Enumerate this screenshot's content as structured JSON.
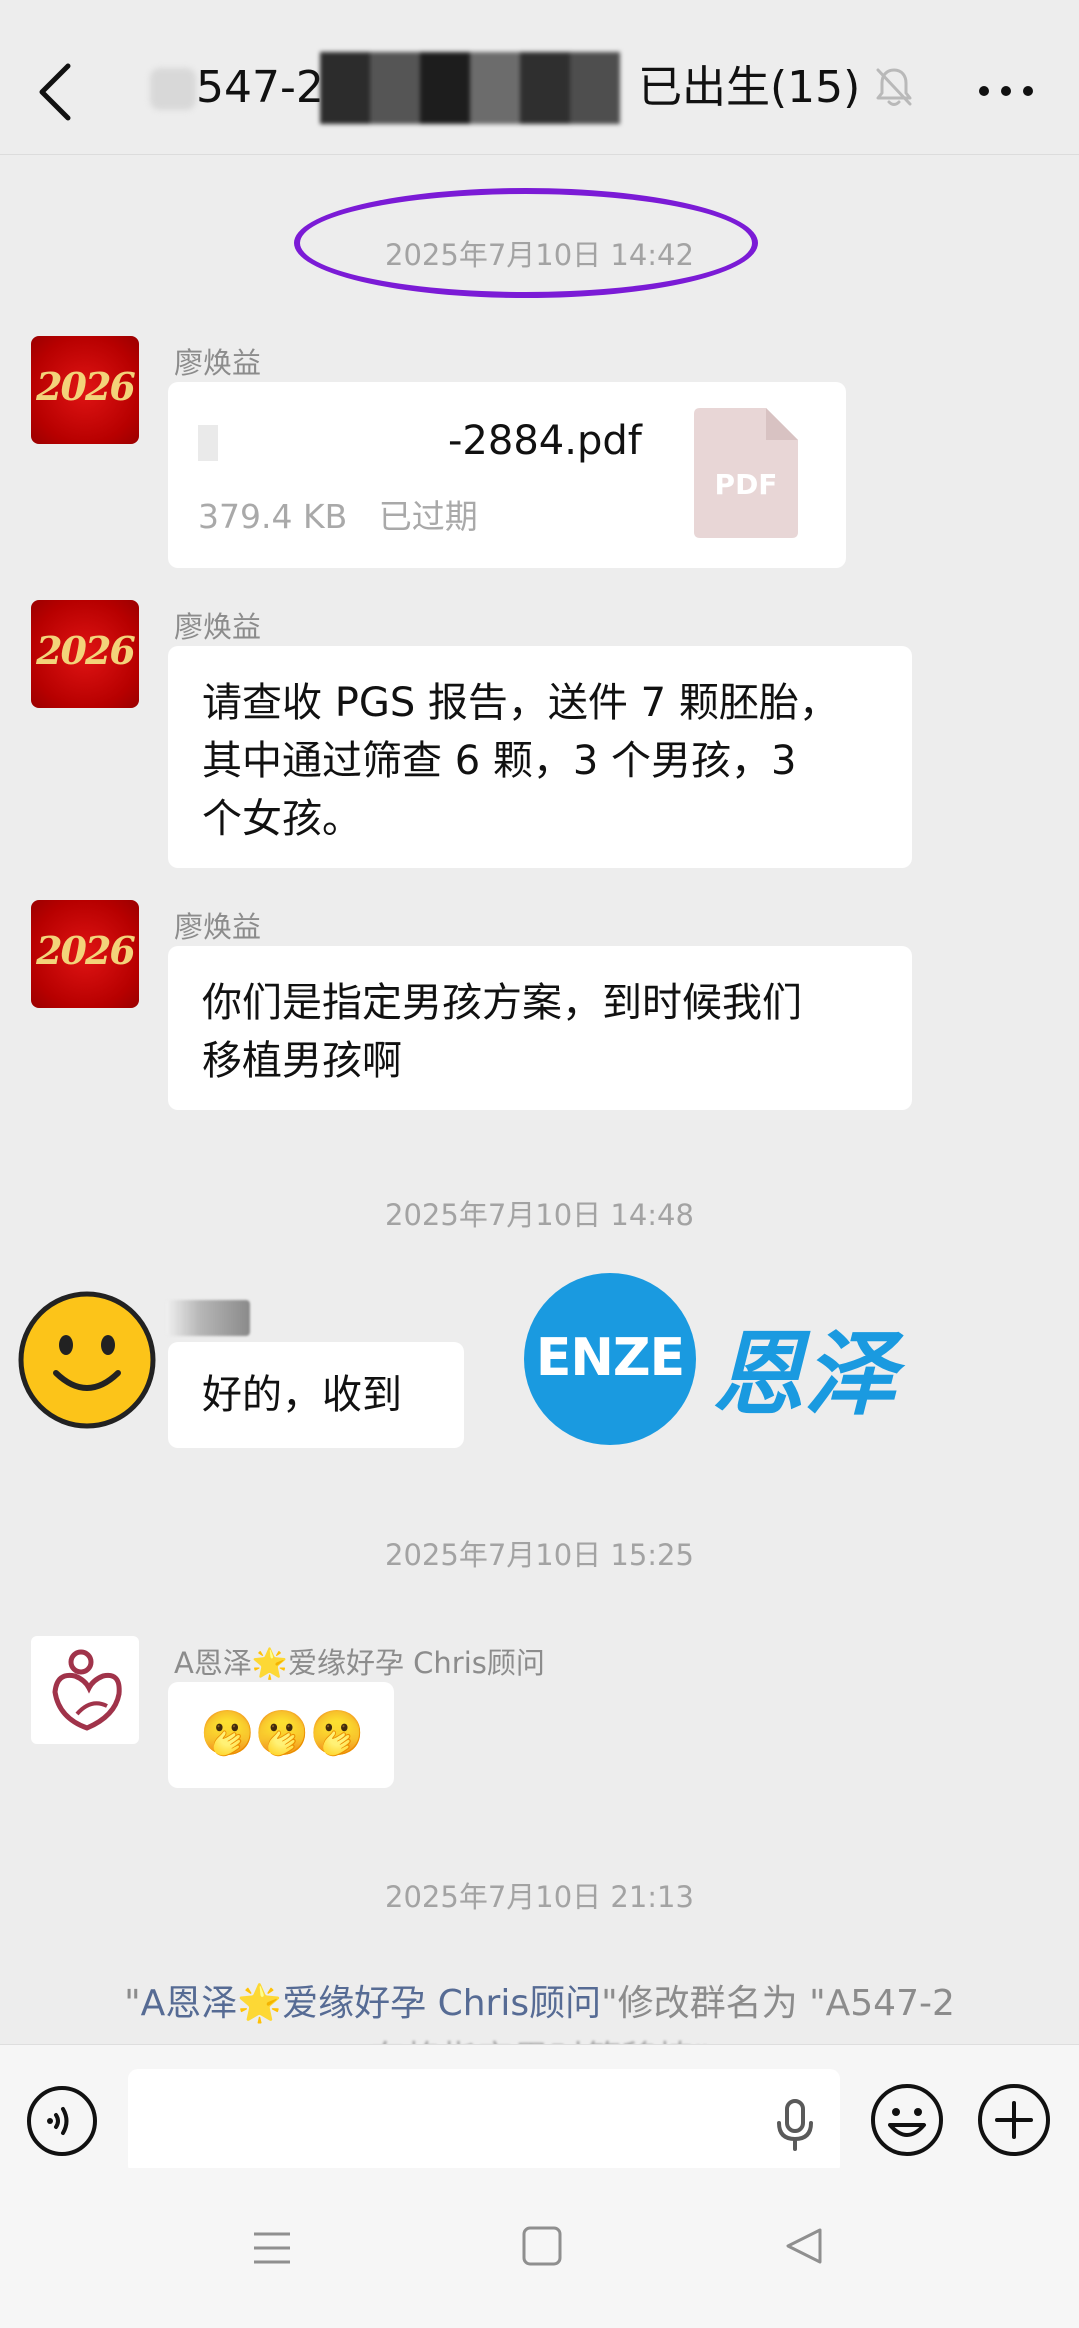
{
  "header": {
    "title_left": "547-2",
    "title_right": "已出生(15)",
    "back_icon": "chevron-left-icon",
    "mute_icon": "bell-off-icon",
    "more_icon": "more-dots-icon"
  },
  "timestamps": [
    "2025年7月10日 14:42",
    "2025年7月10日 14:48",
    "2025年7月10日 15:25",
    "2025年7月10日 21:13"
  ],
  "messages": [
    {
      "sender": "廖焕益",
      "avatar_text": "2026",
      "type": "file",
      "file_name": "-2884.pdf",
      "file_size": "379.4 KB",
      "file_status": "已过期",
      "file_icon_label": "PDF"
    },
    {
      "sender": "廖焕益",
      "avatar_text": "2026",
      "type": "text",
      "lines": [
        "请查收 PGS 报告，送件 7 颗胚胎，",
        "其中通过筛查 6 颗，3 个男孩，3",
        "个女孩。"
      ]
    },
    {
      "sender": "廖焕益",
      "avatar_text": "2026",
      "type": "text",
      "lines": [
        "你们是指定男孩方案，到时候我们",
        "移植男孩啊"
      ]
    },
    {
      "type": "text",
      "text": "好的，收到"
    },
    {
      "sender": "A恩泽🌟爱缘好孕 Chris顾问",
      "type": "emoji",
      "text": "🫢🫢🫢"
    }
  ],
  "system_notice": {
    "quote_open": "\"",
    "actor": "A恩泽🌟爱缘好孕 Chris顾问",
    "action": "\"修改群名为 \"A547-2",
    "line2": "东格指定男时筛移植\""
  },
  "watermark": {
    "brand_en": "ENZE",
    "brand_cn": "恩泽"
  },
  "input": {
    "placeholder": ""
  },
  "colors": {
    "background": "#ededed",
    "bubble": "#ffffff",
    "timestamp": "#a3a3a3",
    "oval": "#7b1bd6",
    "brand_blue": "#1a9ae0",
    "link_blue": "#566b94"
  }
}
